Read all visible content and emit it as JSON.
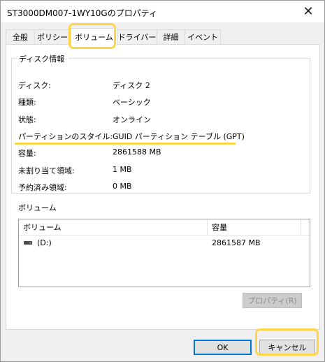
{
  "window": {
    "title": "ST3000DM007-1WY10Gのプロパティ",
    "close_glyph": "✕"
  },
  "tabs": [
    {
      "label": "全般",
      "active": false
    },
    {
      "label": "ポリシー",
      "active": false
    },
    {
      "label": "ボリューム",
      "active": true
    },
    {
      "label": "ドライバー",
      "active": false
    },
    {
      "label": "詳細",
      "active": false
    },
    {
      "label": "イベント",
      "active": false
    }
  ],
  "disk_info": {
    "group_title": "ディスク情報",
    "rows": [
      {
        "label": "ディスク:",
        "value": "ディスク 2"
      },
      {
        "label": "種類:",
        "value": "ベーシック"
      },
      {
        "label": "状態:",
        "value": "オンライン"
      },
      {
        "label": "パーティションのスタイル:",
        "value": "GUID パーティション テーブル (GPT)"
      },
      {
        "label": "容量:",
        "value": "2861588 MB"
      },
      {
        "label": "未割り当て領域:",
        "value": "1 MB"
      },
      {
        "label": "予約済み領域:",
        "value": "0 MB"
      }
    ]
  },
  "volumes": {
    "title": "ボリューム",
    "columns": [
      "ボリューム",
      "容量"
    ],
    "rows": [
      {
        "icon": "drive-icon",
        "name": "(D:)",
        "capacity": "2861587 MB"
      }
    ],
    "properties_button": "プロパティ(R)"
  },
  "buttons": {
    "ok": "OK",
    "cancel": "キャンセル"
  },
  "colors": {
    "highlight": "#ffd54a",
    "focus_border": "#0078d7"
  }
}
